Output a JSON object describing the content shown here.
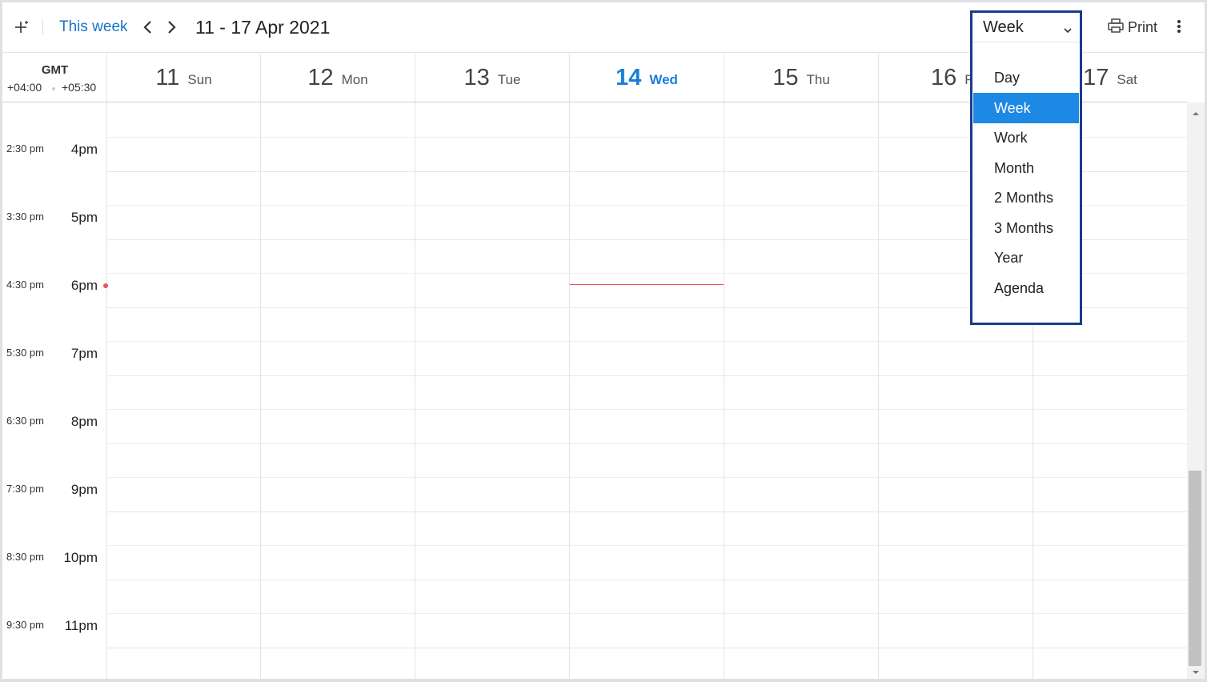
{
  "toolbar": {
    "this_week": "This week",
    "date_range": "11 - 17 Apr 2021",
    "print": "Print",
    "view_selected": "Week"
  },
  "view_menu": {
    "options": [
      "Day",
      "Week",
      "Work",
      "Month",
      "2 Months",
      "3 Months",
      "Year",
      "Agenda"
    ],
    "active": "Week"
  },
  "timezone": {
    "title": "GMT",
    "primary": "+04:00",
    "secondary": "+05:30"
  },
  "days": [
    {
      "num": "11",
      "name": "Sun"
    },
    {
      "num": "12",
      "name": "Mon"
    },
    {
      "num": "13",
      "name": "Tue"
    },
    {
      "num": "14",
      "name": "Wed",
      "today": true
    },
    {
      "num": "15",
      "name": "Thu"
    },
    {
      "num": "16",
      "name": "Fri"
    },
    {
      "num": "17",
      "name": "Sat"
    }
  ],
  "hours": [
    {
      "secondary": "2:30 pm",
      "primary": "4pm"
    },
    {
      "secondary": "3:30 pm",
      "primary": "5pm"
    },
    {
      "secondary": "4:30 pm",
      "primary": "6pm"
    },
    {
      "secondary": "5:30 pm",
      "primary": "7pm"
    },
    {
      "secondary": "6:30 pm",
      "primary": "8pm"
    },
    {
      "secondary": "7:30 pm",
      "primary": "9pm"
    },
    {
      "secondary": "8:30 pm",
      "primary": "10pm"
    },
    {
      "secondary": "9:30 pm",
      "primary": "11pm"
    }
  ],
  "colors": {
    "accent": "#1a7ed9",
    "menu_active": "#1e88e5",
    "menu_border": "#1b3a8c",
    "now_indicator": "#e05252"
  },
  "icons": {
    "magic": "sparkle-icon",
    "prev": "chevron-left-icon",
    "next": "chevron-right-icon",
    "print": "printer-icon",
    "more": "more-vertical-icon"
  }
}
